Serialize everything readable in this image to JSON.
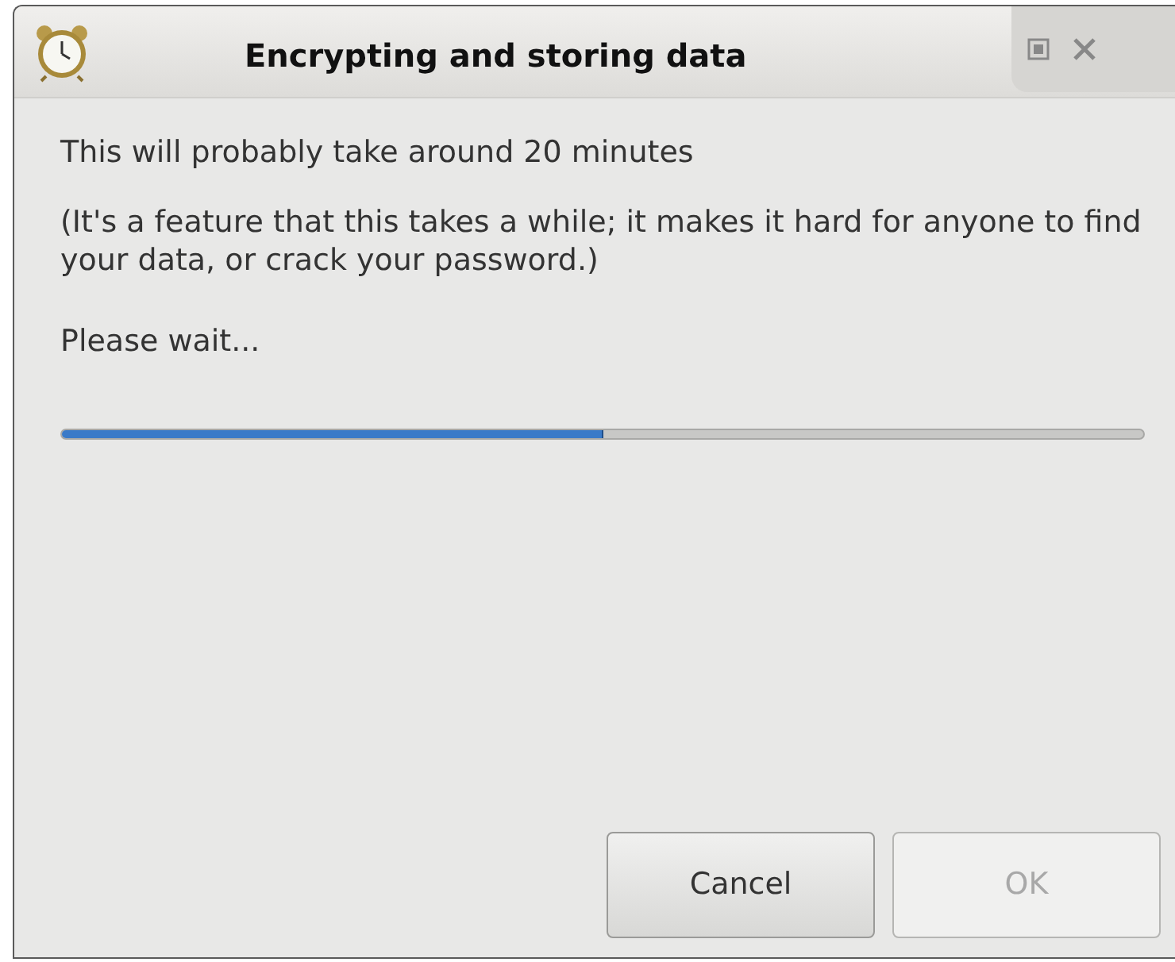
{
  "window": {
    "title": "Encrypting and storing data",
    "controls": [
      {
        "kind": "maximize"
      },
      {
        "kind": "close"
      }
    ]
  },
  "messages": [
    "This will probably take around 20 minutes",
    "(It's a feature that this takes a while; it makes it hard for anyone to find your data, or crack your password.)",
    "Please wait..."
  ],
  "progress": {
    "level": 0.5
  },
  "buttons": [
    {
      "label": "Cancel",
      "disabled": false
    },
    {
      "label": "OK",
      "disabled": true
    }
  ]
}
